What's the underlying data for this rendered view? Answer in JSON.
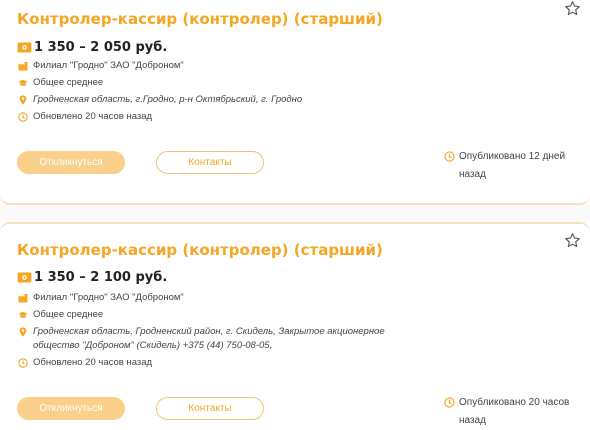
{
  "colors": {
    "accent": "#f5a623",
    "button_fill": "#fad08a",
    "divider": "#f6e2bf"
  },
  "vacancies": [
    {
      "title": "Контролер-кассир (контролер) (старший)",
      "salary": "1 350 – 2 050 руб.",
      "employer": "Филиал \"Гродно\" ЗАО \"Доброном\"",
      "education": "Общее среднее",
      "location": "Гродненская область, г.Гродно, р-н Октябрьский, г. Гродно",
      "updated": "Обновлено 20 часов назад",
      "apply_label": "Откликнуться",
      "contacts_label": "Контакты",
      "published": "Опубликовано 12 дней назад",
      "icons": [
        "star-icon",
        "money-icon",
        "building-icon",
        "graduation-cap-icon",
        "location-pin-icon",
        "clock-icon"
      ]
    },
    {
      "title": "Контролер-кассир (контролер) (старший)",
      "salary": "1 350 – 2 100 руб.",
      "employer": "Филиал \"Гродно\" ЗАО \"Доброном\"",
      "education": "Общее среднее",
      "location": "Гродненская область, Гродненский район, г. Скидель, Закрытое акционерное общество \"Доброном\" (Скидель) +375 (44) 750-08-05,",
      "updated": "Обновлено 20 часов назад",
      "apply_label": "Откликнуться",
      "contacts_label": "Контакты",
      "published": "Опубликовано 20 часов назад",
      "icons": [
        "star-icon",
        "money-icon",
        "building-icon",
        "graduation-cap-icon",
        "location-pin-icon",
        "clock-icon"
      ]
    }
  ]
}
